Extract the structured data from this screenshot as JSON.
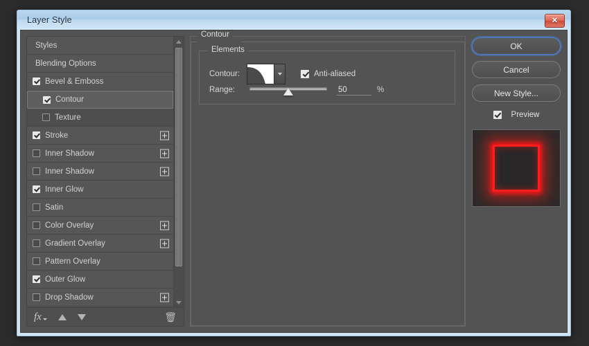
{
  "window": {
    "title": "Layer Style",
    "close_label": "✕"
  },
  "styles_panel": {
    "items": [
      {
        "label": "Styles",
        "type": "plain",
        "checkbox": null,
        "has_plus": false,
        "selected": false
      },
      {
        "label": "Blending Options",
        "type": "plain",
        "checkbox": null,
        "has_plus": false,
        "selected": false
      },
      {
        "label": "Bevel & Emboss",
        "type": "effect",
        "checkbox": true,
        "has_plus": false,
        "selected": false
      },
      {
        "label": "Contour",
        "type": "sub",
        "checkbox": true,
        "has_plus": false,
        "selected": true
      },
      {
        "label": "Texture",
        "type": "sub",
        "checkbox": false,
        "has_plus": false,
        "selected": false
      },
      {
        "label": "Stroke",
        "type": "effect",
        "checkbox": true,
        "has_plus": true,
        "selected": false
      },
      {
        "label": "Inner Shadow",
        "type": "effect",
        "checkbox": false,
        "has_plus": true,
        "selected": false
      },
      {
        "label": "Inner Shadow",
        "type": "effect",
        "checkbox": false,
        "has_plus": true,
        "selected": false
      },
      {
        "label": "Inner Glow",
        "type": "effect",
        "checkbox": true,
        "has_plus": false,
        "selected": false
      },
      {
        "label": "Satin",
        "type": "effect",
        "checkbox": false,
        "has_plus": false,
        "selected": false
      },
      {
        "label": "Color Overlay",
        "type": "effect",
        "checkbox": false,
        "has_plus": true,
        "selected": false
      },
      {
        "label": "Gradient Overlay",
        "type": "effect",
        "checkbox": false,
        "has_plus": true,
        "selected": false
      },
      {
        "label": "Pattern Overlay",
        "type": "effect",
        "checkbox": false,
        "has_plus": false,
        "selected": false
      },
      {
        "label": "Outer Glow",
        "type": "effect",
        "checkbox": true,
        "has_plus": false,
        "selected": false
      },
      {
        "label": "Drop Shadow",
        "type": "effect",
        "checkbox": false,
        "has_plus": true,
        "selected": false
      }
    ],
    "footer": {
      "fx_icon": "fx",
      "move_up_icon": "arrow-up-icon",
      "move_down_icon": "arrow-down-icon",
      "delete_icon": "🗑"
    }
  },
  "settings": {
    "group_title": "Contour",
    "elements_title": "Elements",
    "contour_label": "Contour:",
    "antialiased_label": "Anti-aliased",
    "antialiased_checked": true,
    "range_label": "Range:",
    "range_value": "50",
    "range_unit": "%",
    "range_percent": 50
  },
  "actions": {
    "ok_label": "OK",
    "cancel_label": "Cancel",
    "new_style_label": "New Style...",
    "preview_label": "Preview",
    "preview_checked": true
  },
  "colors": {
    "dialog_bg": "#535353",
    "titlebar": "#b9d6ee",
    "accent_focus": "#4f7fd0",
    "glow_red": "#ff1c1c",
    "preview_bg": "#2a2a2a"
  }
}
